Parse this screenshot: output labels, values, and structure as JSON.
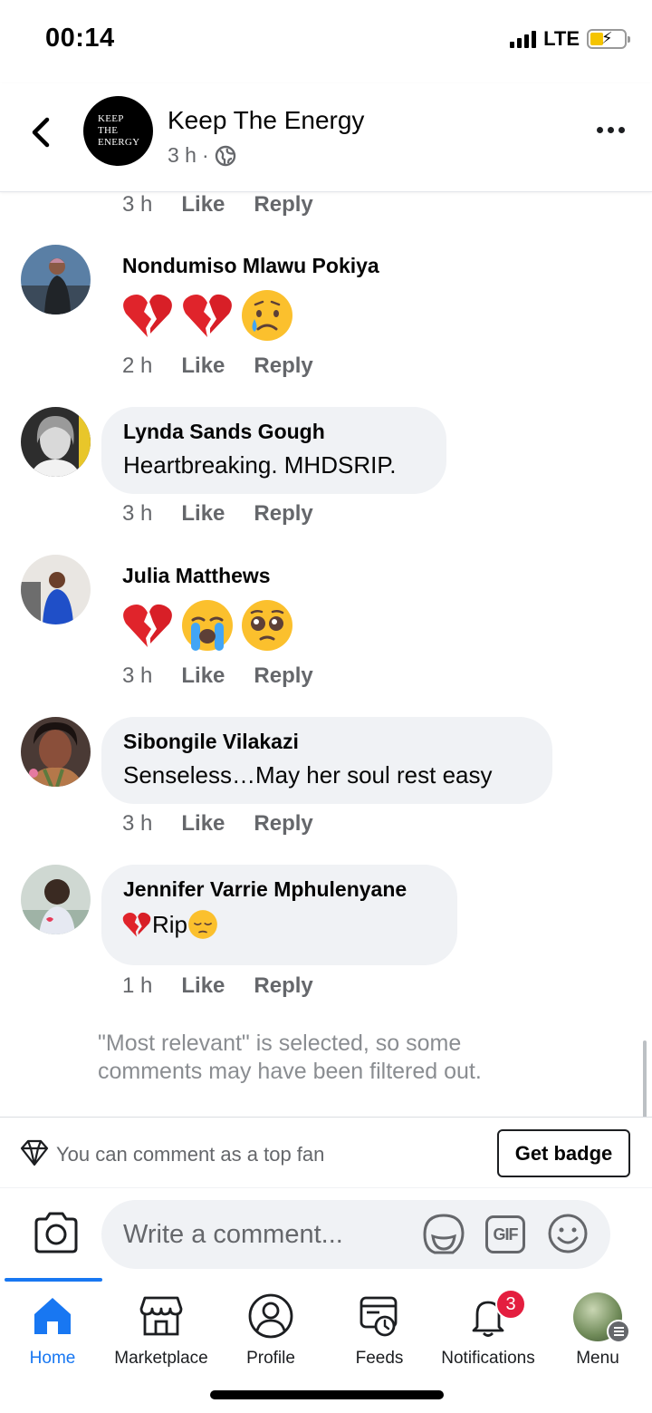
{
  "status_bar": {
    "time": "00:14",
    "network": "LTE"
  },
  "header": {
    "logo_lines": [
      "Keep",
      "The",
      "Energy"
    ],
    "title": "Keep The Energy",
    "meta_time": "3 h",
    "meta_separator": "·"
  },
  "comments": {
    "prev_actions": {
      "time": "3 h",
      "like": "Like",
      "reply": "Reply"
    },
    "items": [
      {
        "name": "Nondumiso Mlawu Pokiya",
        "text": "",
        "emojis": [
          "broken-heart",
          "broken-heart",
          "sad-tear-face"
        ],
        "time": "2 h",
        "like": "Like",
        "reply": "Reply"
      },
      {
        "name": "Lynda Sands Gough",
        "text": "Heartbreaking. MHDSRIP.",
        "time": "3 h",
        "like": "Like",
        "reply": "Reply"
      },
      {
        "name": "Julia Matthews",
        "text": "",
        "emojis": [
          "broken-heart",
          "loudly-crying-face",
          "pleading-face"
        ],
        "time": "3 h",
        "like": "Like",
        "reply": "Reply"
      },
      {
        "name": "Sibongile Vilakazi",
        "text": "Senseless…May her soul rest easy",
        "time": "3 h",
        "like": "Like",
        "reply": "Reply"
      },
      {
        "name": "Jennifer Varrie Mphulenyane",
        "text": "Rip",
        "emojis": [
          "broken-heart",
          "pensive-face"
        ],
        "time": "1 h",
        "like": "Like",
        "reply": "Reply"
      }
    ],
    "filter_note": "\"Most relevant\" is selected, so some comments may have been filtered out."
  },
  "top_fan": {
    "text": "You can comment as a top fan",
    "button": "Get badge"
  },
  "composer": {
    "placeholder": "Write a comment...",
    "gif_label": "GIF"
  },
  "tabbar": {
    "tabs": [
      {
        "label": "Home",
        "icon": "home-icon",
        "active": true
      },
      {
        "label": "Marketplace",
        "icon": "marketplace-icon"
      },
      {
        "label": "Profile",
        "icon": "profile-icon"
      },
      {
        "label": "Feeds",
        "icon": "feeds-icon"
      },
      {
        "label": "Notifications",
        "icon": "bell-icon",
        "badge": "3"
      },
      {
        "label": "Menu",
        "icon": "menu-avatar"
      }
    ]
  },
  "colors": {
    "accent": "#1877f2",
    "badge": "#e41e3f",
    "bubble": "#f0f2f5",
    "secondary_text": "#65676b"
  }
}
